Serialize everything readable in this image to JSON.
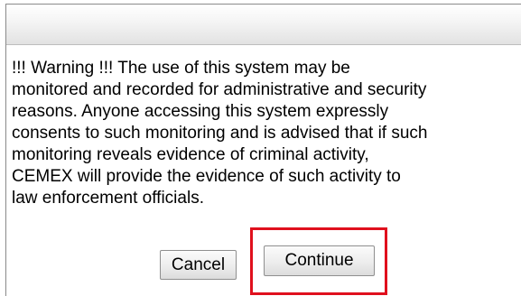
{
  "dialog": {
    "message": "!!! Warning !!! The use of this system may be\nmonitored and recorded for administrative and security\nreasons. Anyone accessing this system expressly\nconsents to such monitoring and is advised that if such\nmonitoring reveals evidence of criminal activity,\nCEMEX will provide the evidence of such activity to\nlaw enforcement officials.",
    "cancel_label": "Cancel",
    "continue_label": "Continue"
  },
  "colors": {
    "highlight": "#e0101d",
    "button_border": "#8f8f8f"
  }
}
